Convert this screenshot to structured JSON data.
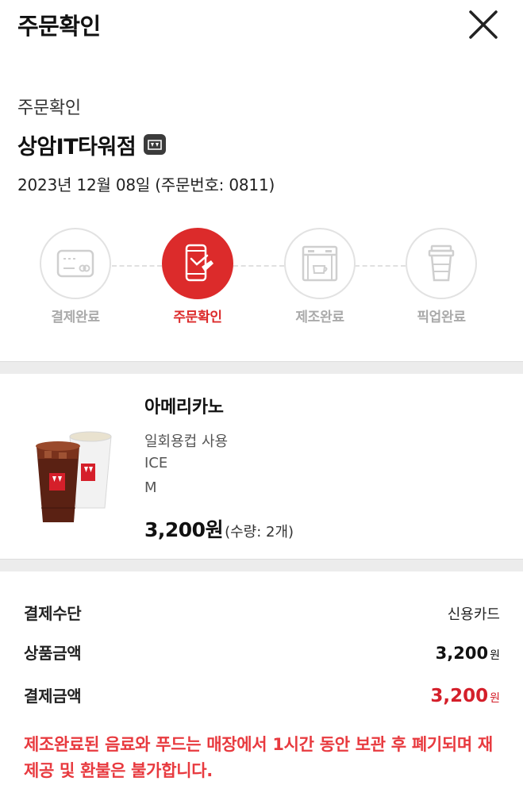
{
  "header": {
    "title": "주문확인"
  },
  "order": {
    "section_title": "주문확인",
    "store_name": "상암IT타워점",
    "date_line": "2023년 12월 08일 (주문번호: 0811)"
  },
  "steps": [
    {
      "label": "결제완료",
      "icon": "card-icon",
      "active": false
    },
    {
      "label": "주문확인",
      "icon": "phone-order-icon",
      "active": true
    },
    {
      "label": "제조완료",
      "icon": "coffee-machine-icon",
      "active": false
    },
    {
      "label": "픽업완료",
      "icon": "takeout-cup-icon",
      "active": false
    }
  ],
  "product": {
    "name": "아메리카노",
    "options": [
      "일회용컵 사용",
      "ICE",
      "M"
    ],
    "price": "3,200원",
    "quantity": "(수량: 2개)",
    "image": "iced-americano-cups-image"
  },
  "payment": {
    "method_label": "결제수단",
    "method_value": "신용카드",
    "item_amount_label": "상품금액",
    "item_amount_value": "3,200",
    "total_label": "결제금액",
    "total_value": "3,200",
    "currency_unit": "원"
  },
  "notice": "제조완료된 음료와 푸드는 매장에서 1시간 동안 보관 후 폐기되며 재제공 및 환불은 불가합니다.",
  "colors": {
    "brand_red": "#dc2b2b",
    "notice_red": "#e83a3f",
    "inactive_gray": "#aaaaaa"
  }
}
